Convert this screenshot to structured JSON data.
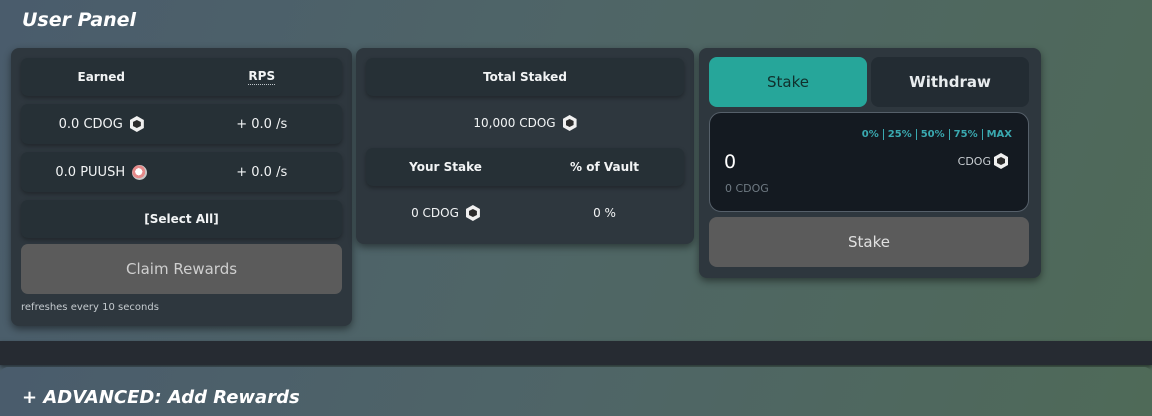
{
  "panel_title": "User Panel",
  "rewards_card": {
    "headers": {
      "earned": "Earned",
      "rps": "RPS"
    },
    "rows": [
      {
        "earned": "0.0 CDOG",
        "icon": "cdog-token-icon",
        "rps": "+ 0.0 /s"
      },
      {
        "earned": "0.0 PUUSH",
        "icon": "puush-token-icon",
        "rps": "+ 0.0 /s"
      }
    ],
    "select_all": "[Select All]",
    "claim_label": "Claim Rewards",
    "refresh_note": "refreshes every 10 seconds"
  },
  "vault_card": {
    "total_staked_label": "Total Staked",
    "total_staked_value": "10,000 CDOG",
    "your_stake_label": "Your Stake",
    "pct_vault_label": "% of Vault",
    "your_stake_value": "0 CDOG",
    "pct_vault_value": "0 %"
  },
  "stake_card": {
    "tabs": {
      "stake": "Stake",
      "withdraw": "Withdraw"
    },
    "active_tab": "stake",
    "percent_options": [
      "0%",
      "25%",
      "50%",
      "75%",
      "MAX"
    ],
    "amount_value": "0",
    "token_label": "CDOG",
    "sub_amount": "0 CDOG",
    "submit_label": "Stake"
  },
  "advanced": {
    "title": "+ ADVANCED: Add Rewards"
  },
  "colors": {
    "accent": "#26a69a",
    "card_bg": "#2e373e",
    "row_bg": "#263036",
    "disabled_btn": "#5b5b5b",
    "percent_link": "#3aa9b0"
  }
}
